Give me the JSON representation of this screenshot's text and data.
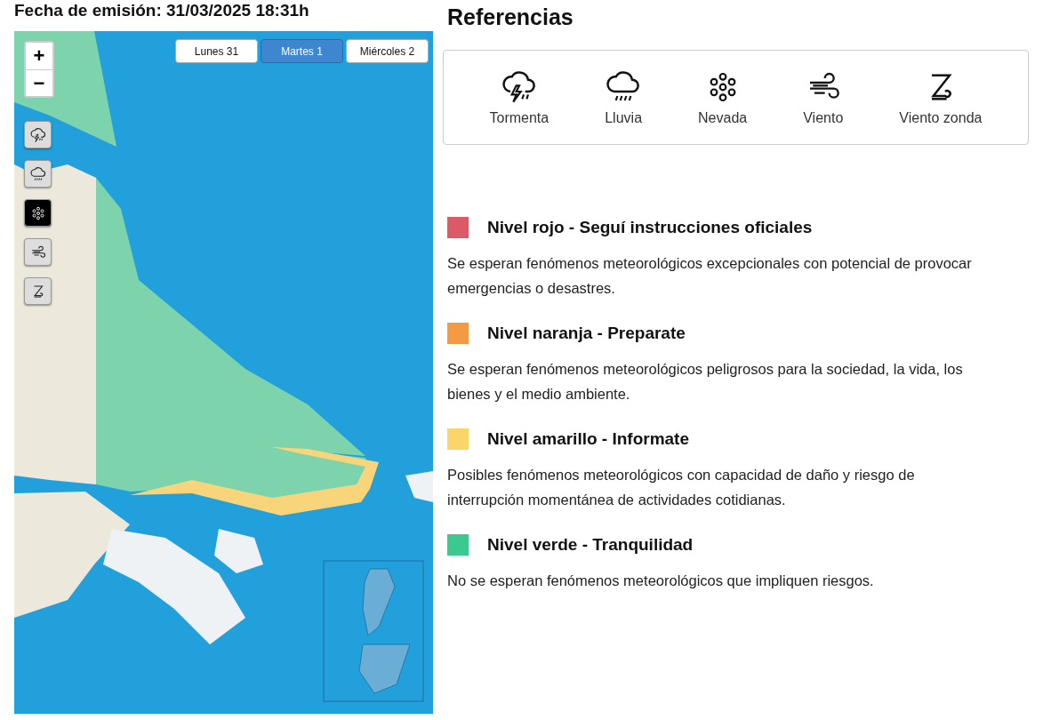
{
  "header": {
    "title": "Fecha de emisión: 31/03/2025 18:31h"
  },
  "map": {
    "zoom_controls": [
      {
        "label": "+"
      },
      {
        "label": "−"
      }
    ],
    "day_tabs": [
      {
        "label": "Lunes 31",
        "selected": false
      },
      {
        "label": "Martes 1",
        "selected": true
      },
      {
        "label": "Miércoles 2",
        "selected": false
      }
    ],
    "layer_buttons": [
      {
        "kind": "storm",
        "selected": false
      },
      {
        "kind": "rain",
        "selected": false
      },
      {
        "kind": "snow",
        "selected": true
      },
      {
        "kind": "wind",
        "selected": false
      },
      {
        "kind": "zonda",
        "selected": false
      }
    ]
  },
  "references": {
    "title": "Referencias",
    "items": [
      {
        "kind": "storm",
        "label": "Tormenta"
      },
      {
        "kind": "rain",
        "label": "Lluvia"
      },
      {
        "kind": "snow",
        "label": "Nevada"
      },
      {
        "kind": "wind",
        "label": "Viento"
      },
      {
        "kind": "zonda",
        "label": "Viento zonda"
      }
    ]
  },
  "levels": [
    {
      "color": "#dc5a68",
      "title": "Nivel rojo - Seguí instrucciones oficiales",
      "description": "Se esperan fenómenos meteorológicos excepcionales con potencial de provocar emergencias o desastres."
    },
    {
      "color": "#f39a45",
      "title": "Nivel naranja - Preparate",
      "description": "Se esperan fenómenos meteorológicos peligrosos para la sociedad, la vida, los bienes y el medio ambiente."
    },
    {
      "color": "#fbd46a",
      "title": "Nivel amarillo - Informate",
      "description": "Posibles fenómenos meteorológicos con capacidad de daño y riesgo de interrupción momentánea de actividades cotidianas."
    },
    {
      "color": "#3ac98e",
      "title": "Nivel verde - Tranquilidad",
      "description": "No se esperan fenómenos meteorológicos que impliquen riesgos."
    }
  ]
}
